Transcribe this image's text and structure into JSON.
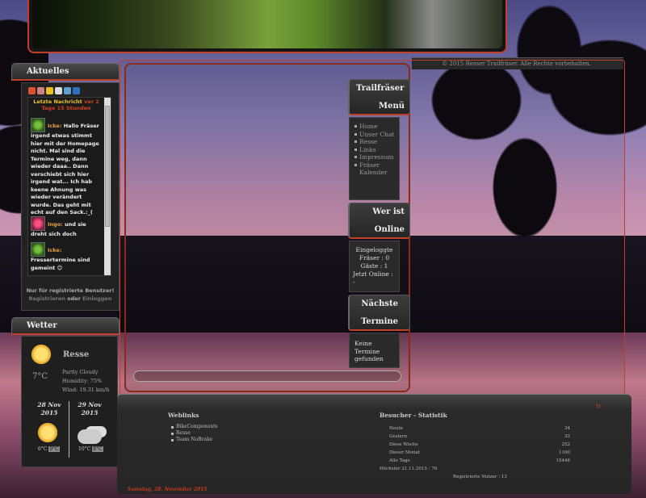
{
  "copyright": "© 2015 Resser Trailfräser. Alle Rechte vorbehalten.",
  "aktuelles": {
    "title": "Aktuelles",
    "latest_label": "Letzte Nachricht",
    "latest_ago": "vor 2 Tage 15 Stunden",
    "messages": [
      {
        "user": "Icke:",
        "text": "Hallo Fräser irgend etwas stimmt hier mit der Homepage nicht. Mal sind die Termine weg, dann wieder daaa.. Dann verschiebt sich hier irgend wat... Ich hab keene Ahnung was wieder verändert wurde. Das geht mit echt auf den Sack.:_("
      },
      {
        "user": "Ingo:",
        "text": "und sie dreht sich doch"
      },
      {
        "user": "Icke:",
        "text": "Fressertermine sind gemeint 😊"
      }
    ],
    "reg_note": "Nur für registrierte Benutzer!",
    "register": "Registrieren",
    "or": "oder",
    "login": "Einloggen"
  },
  "wetter": {
    "title": "Wetter",
    "city": "Resse",
    "temp": "7°C",
    "condition": "Partly Cloudy",
    "humidity": "Humidity: 75%",
    "wind": "Wind: 19.31 km/h",
    "day1": "28 Nov 2015",
    "day1_low": "6°C",
    "day1_high": "9°C",
    "day2": "29 Nov 2015",
    "day2_low": "10°C",
    "day2_high": "8°C"
  },
  "nav": {
    "menu_title_1": "Trailfräser",
    "menu_title_2": "Menü",
    "menu_items": [
      "Home",
      "Unser Chat",
      "Resse",
      "Links",
      "Impressum",
      "Fräser Kalender"
    ],
    "online_title_1": "Wer ist",
    "online_title_2": "Online",
    "online_line1": "Eingeloggte Fräser : 0",
    "online_line2": "Gäste : 1",
    "online_line3": "Jetzt Online :",
    "online_line4": "-",
    "termine_title_1": "Nächste",
    "termine_title_2": "Termine",
    "termine_text": "Keine Termine gefunden"
  },
  "footer": {
    "weblinks_title": "Weblinks",
    "weblinks": [
      "BikeComponents",
      "Resse",
      "Team NoBrake"
    ],
    "stats_title": "Besucher - Statistik",
    "stats": [
      {
        "label": "Heute",
        "value": "34"
      },
      {
        "label": "Gestern",
        "value": "32"
      },
      {
        "label": "Diese Woche",
        "value": "252"
      },
      {
        "label": "Dieser Monat",
        "value": "1160"
      },
      {
        "label": "Alle Tage",
        "value": "15446"
      }
    ],
    "highest": "Höchster 21.11.2015 : 76",
    "registered": "Registrierte Nutzer : 13",
    "date": "Samstag, 28. November 2015",
    "top_link": "⇈"
  }
}
